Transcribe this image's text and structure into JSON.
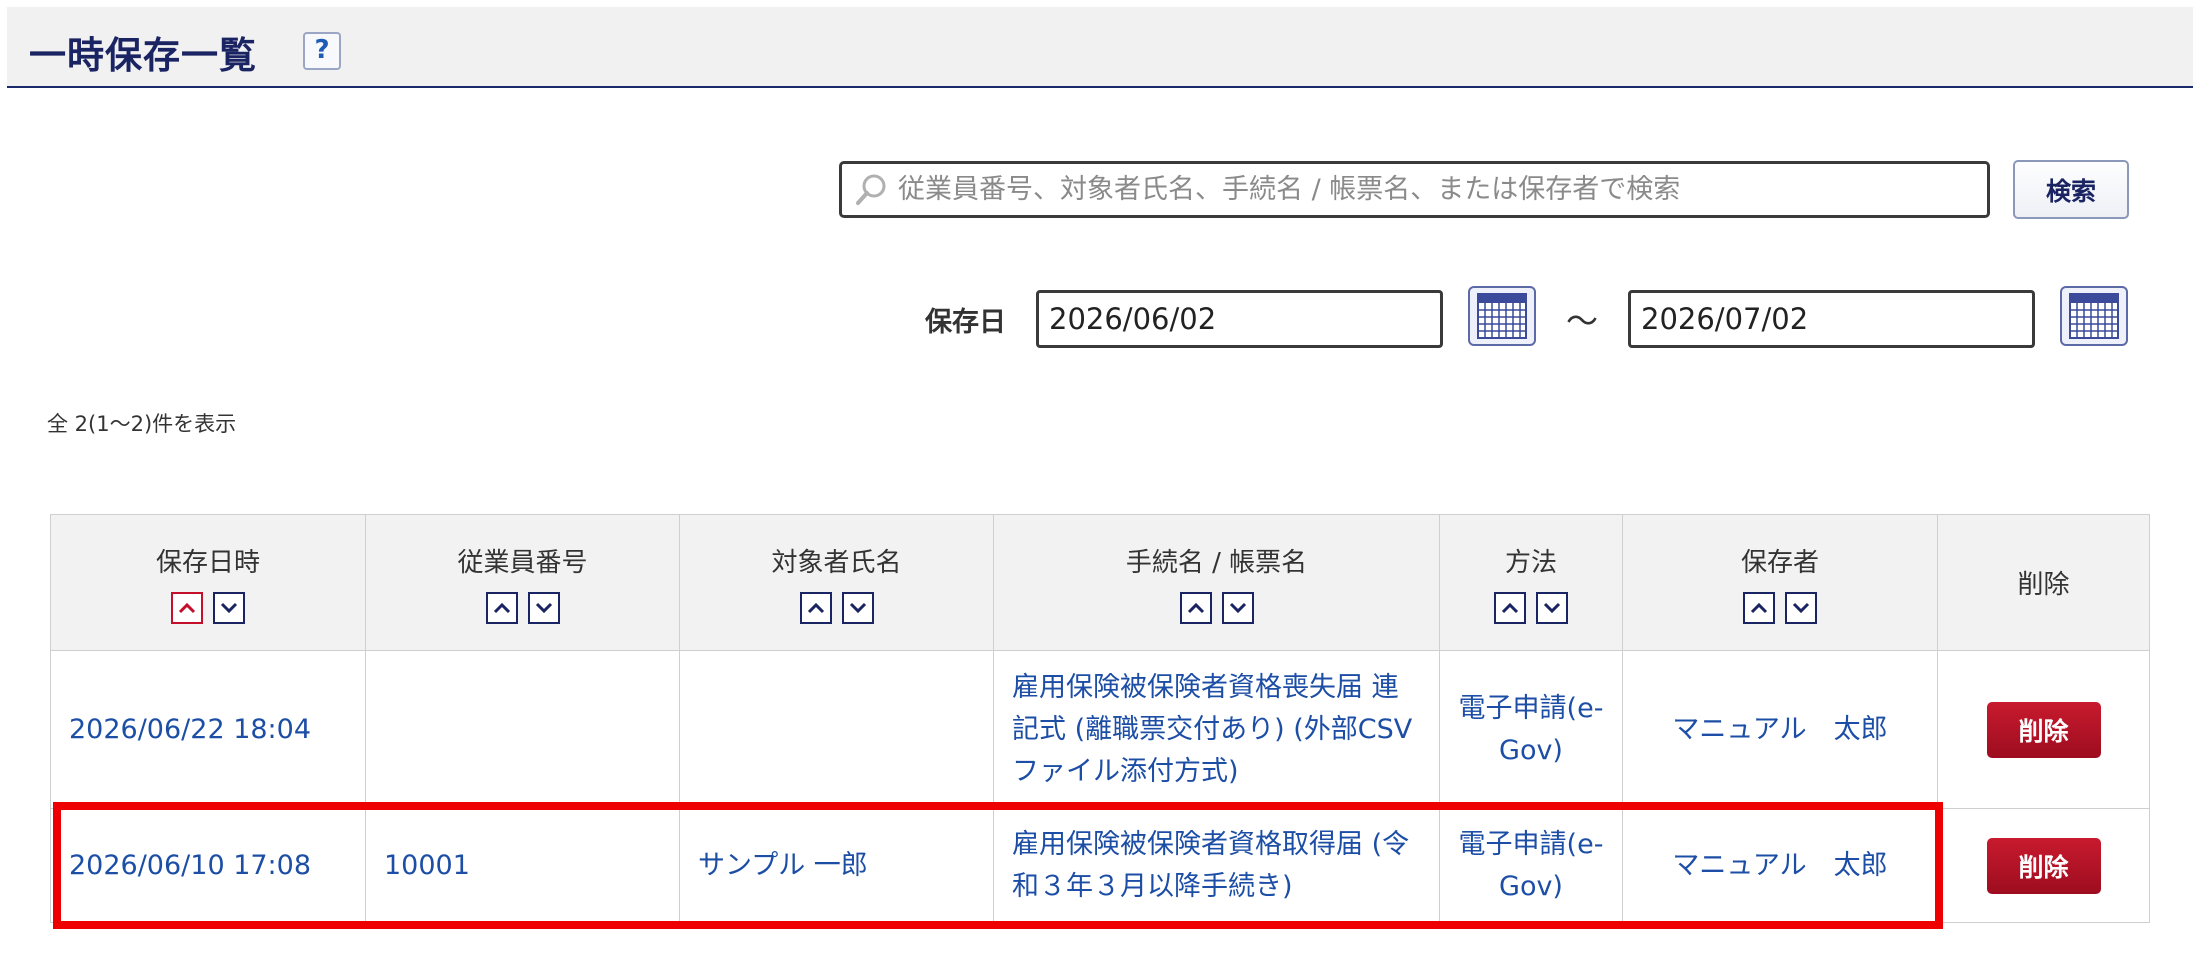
{
  "header": {
    "title": "一時保存一覧",
    "help_label": "?"
  },
  "search": {
    "placeholder": "従業員番号、対象者氏名、手続名 / 帳票名、または保存者で検索",
    "value": "",
    "button_label": "検索"
  },
  "date_filter": {
    "label": "保存日",
    "from": "2026/06/02",
    "separator": "～",
    "to": "2026/07/02"
  },
  "result_count": "全 2(1～2)件を表示",
  "table": {
    "headers": [
      "保存日時",
      "従業員番号",
      "対象者氏名",
      "手続名 / 帳票名",
      "方法",
      "保存者",
      "削除"
    ],
    "rows": [
      {
        "saved_at": "2026/06/22 18:04",
        "employee_no": "",
        "target_name": "",
        "procedure": "雇用保険被保険者資格喪失届 連記式 (離職票交付あり) (外部CSVファイル添付方式)",
        "method": "電子申請(e-Gov)",
        "saved_by": "マニュアル　太郎",
        "delete_label": "削除"
      },
      {
        "saved_at": "2026/06/10 17:08",
        "employee_no": "10001",
        "target_name": "サンプル 一郎",
        "procedure": "雇用保険被保険者資格取得届 (令和３年３月以降手続き)",
        "method": "電子申請(e-Gov)",
        "saved_by": "マニュアル　太郎",
        "delete_label": "削除"
      }
    ]
  },
  "colors": {
    "title": "#1a2463",
    "link": "#1d4ea6",
    "delete_button": "#b3142a",
    "highlight": "#ee0000"
  }
}
